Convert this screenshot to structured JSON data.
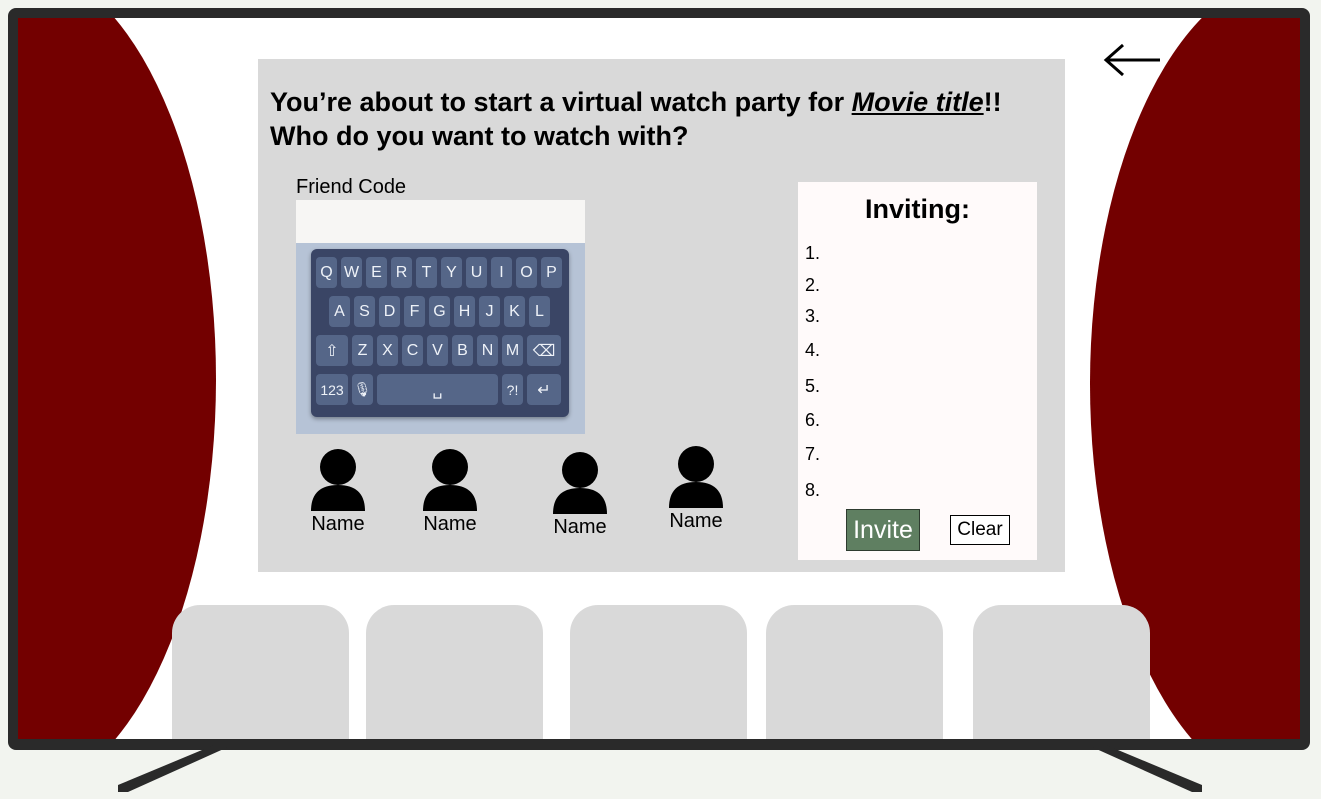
{
  "dialog": {
    "heading_prefix": "You’re about to start a virtual watch party for ",
    "movie_title": "Movie title",
    "heading_suffix": "!!",
    "heading_line2": "Who do you want to watch with?"
  },
  "friend_code": {
    "label": "Friend Code",
    "value": "",
    "placeholder": ""
  },
  "keyboard": {
    "row1": [
      "Q",
      "W",
      "E",
      "R",
      "T",
      "Y",
      "U",
      "I",
      "O",
      "P"
    ],
    "row2": [
      "A",
      "S",
      "D",
      "F",
      "G",
      "H",
      "J",
      "K",
      "L"
    ],
    "row3": [
      "Z",
      "X",
      "C",
      "V",
      "B",
      "N",
      "M"
    ],
    "shift": "⇧",
    "backspace": "⌫",
    "numbers": "123",
    "mic": "🎙",
    "space": "␣",
    "punct": "?!",
    "enter": "↵"
  },
  "friends": [
    {
      "name": "Name"
    },
    {
      "name": "Name"
    },
    {
      "name": "Name"
    },
    {
      "name": "Name"
    }
  ],
  "inviting": {
    "title": "Inviting:",
    "slots": [
      "1.",
      "2.",
      "3.",
      "4.",
      "5.",
      "6.",
      "7.",
      "8."
    ],
    "invite_label": "Invite",
    "clear_label": "Clear"
  },
  "colors": {
    "curtain": "#730000",
    "dialog_bg": "#d9d9d9",
    "invite_button": "#5f7f61",
    "keyboard": "#3a4565"
  },
  "icons": {
    "back": "arrow-left-icon",
    "friend": "person-icon"
  }
}
